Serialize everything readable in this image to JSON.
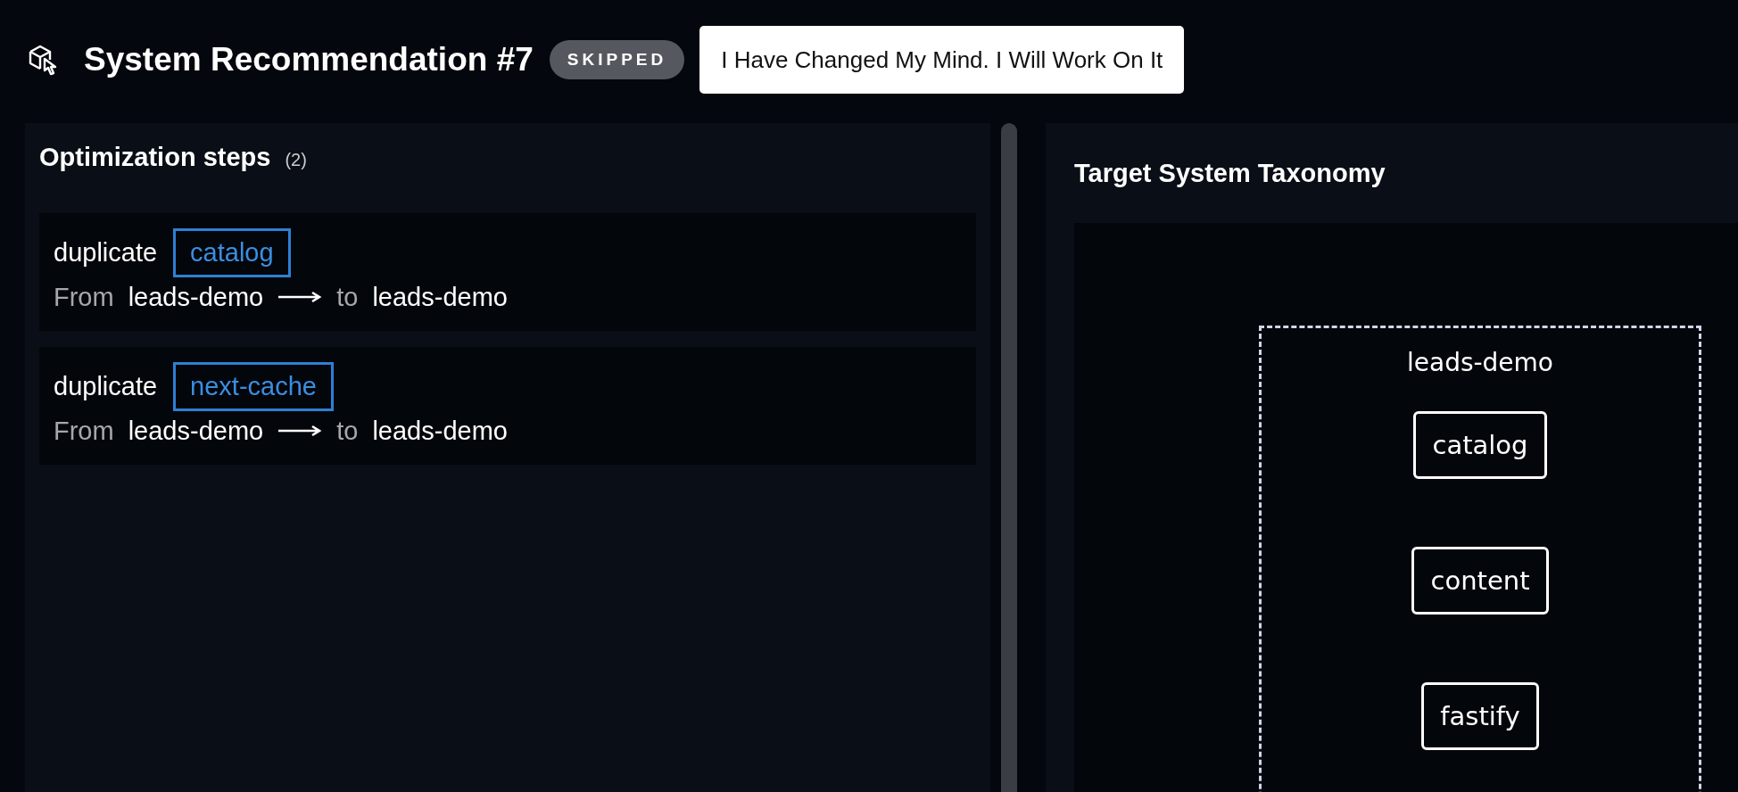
{
  "header": {
    "title": "System Recommendation #7",
    "status": "SKIPPED",
    "action_button": "I Have Changed My Mind. I Will Work On It"
  },
  "steps_panel": {
    "title": "Optimization steps",
    "count": "(2)",
    "steps": [
      {
        "action": "duplicate",
        "item": "catalog",
        "from_label": "From",
        "from": "leads-demo",
        "to_label": "to",
        "to": "leads-demo"
      },
      {
        "action": "duplicate",
        "item": "next-cache",
        "from_label": "From",
        "from": "leads-demo",
        "to_label": "to",
        "to": "leads-demo"
      }
    ]
  },
  "taxonomy_panel": {
    "title": "Target System Taxonomy",
    "group": {
      "label": "leads-demo",
      "nodes": [
        {
          "label": "catalog"
        },
        {
          "label": "content"
        },
        {
          "label": "fastify"
        }
      ]
    }
  }
}
